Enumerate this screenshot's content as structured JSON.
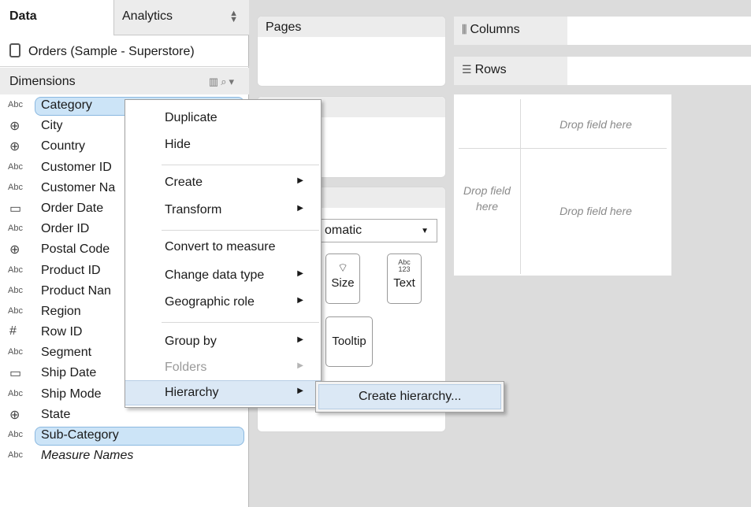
{
  "tabs": {
    "data": "Data",
    "analytics": "Analytics"
  },
  "datasource": {
    "name": "Orders (Sample - Superstore)"
  },
  "dimensions": {
    "header": "Dimensions",
    "fields": [
      {
        "label": "Category",
        "type": "Abc",
        "icon": "abc-icon",
        "selected": true
      },
      {
        "label": "City",
        "type": "globe",
        "icon": "globe-icon"
      },
      {
        "label": "Country",
        "type": "globe",
        "icon": "globe-icon"
      },
      {
        "label": "Customer ID",
        "type": "Abc",
        "icon": "abc-icon"
      },
      {
        "label": "Customer Na",
        "type": "Abc",
        "icon": "abc-icon"
      },
      {
        "label": "Order Date",
        "type": "date",
        "icon": "calendar-icon"
      },
      {
        "label": "Order ID",
        "type": "Abc",
        "icon": "abc-icon"
      },
      {
        "label": "Postal Code",
        "type": "globe",
        "icon": "globe-icon"
      },
      {
        "label": "Product ID",
        "type": "Abc",
        "icon": "abc-icon"
      },
      {
        "label": "Product Nan",
        "type": "Abc",
        "icon": "abc-icon"
      },
      {
        "label": "Region",
        "type": "Abc",
        "icon": "abc-icon"
      },
      {
        "label": "Row ID",
        "type": "number",
        "icon": "hash-icon"
      },
      {
        "label": "Segment",
        "type": "Abc",
        "icon": "abc-icon"
      },
      {
        "label": "Ship Date",
        "type": "date",
        "icon": "calendar-icon"
      },
      {
        "label": "Ship Mode",
        "type": "Abc",
        "icon": "abc-icon"
      },
      {
        "label": "State",
        "type": "globe",
        "icon": "globe-icon"
      },
      {
        "label": "Sub-Category",
        "type": "Abc",
        "icon": "abc-icon",
        "selected": true
      },
      {
        "label": "Measure Names",
        "type": "Abc",
        "icon": "abc-icon",
        "italic": true
      }
    ]
  },
  "shelves": {
    "pages": "Pages",
    "columns": "Columns",
    "rows": "Rows"
  },
  "marks": {
    "type_partial": "omatic",
    "size": "Size",
    "text": "Text",
    "text_icon": "Abc\n123",
    "tooltip": "Tooltip"
  },
  "view": {
    "drop_top": "Drop field here",
    "drop_left": "Drop field here",
    "drop_center": "Drop field here"
  },
  "context_menu": {
    "items": [
      {
        "label": "Duplicate"
      },
      {
        "label": "Hide"
      },
      {
        "label": "Create",
        "submenu": true
      },
      {
        "label": "Transform",
        "submenu": true
      },
      {
        "label": "Convert to measure"
      },
      {
        "label": "Change data type",
        "submenu": true
      },
      {
        "label": "Geographic role",
        "submenu": true
      },
      {
        "label": "Group by",
        "submenu": true
      },
      {
        "label": "Folders",
        "submenu": true,
        "disabled": true
      },
      {
        "label": "Hierarchy",
        "submenu": true,
        "highlighted": true
      }
    ],
    "submenu_item": "Create hierarchy..."
  },
  "colors": {
    "selection": "#cce4f7",
    "menu_highlight": "#dbe8f5",
    "canvas": "#dcdcdc"
  }
}
